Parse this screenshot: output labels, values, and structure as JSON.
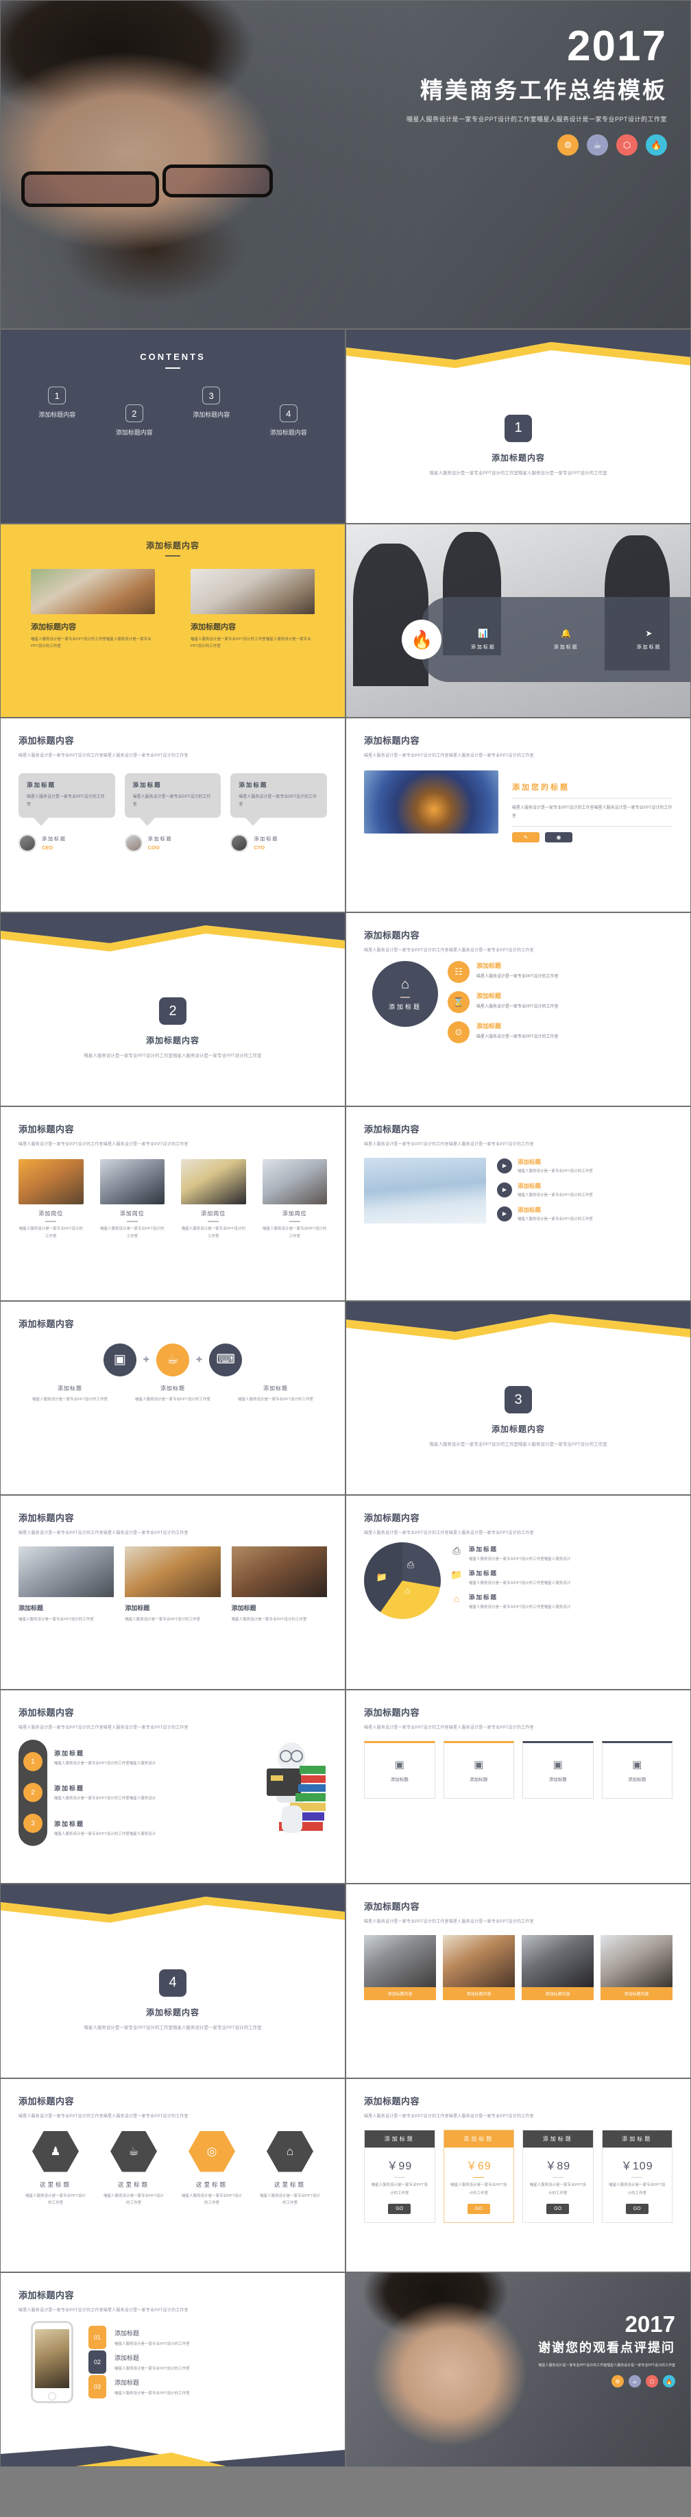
{
  "brand": {
    "navy": "#474d5e",
    "yellow": "#f9cb43",
    "orange": "#f5a93f",
    "gray": "#d8d8d8",
    "dark": "#4a4a4a"
  },
  "cover": {
    "year": "2017",
    "title": "精美商务工作总结模板",
    "subtitle": "喵星人服务设计是一家专业PPT设计的工作室喵星人服务设计是一家专业PPT设计的工作室",
    "icons": [
      {
        "name": "gear-icon",
        "glyph": "⚙",
        "color": "#f5a93f"
      },
      {
        "name": "cup-icon",
        "glyph": "☕",
        "color": "#9aa0c4"
      },
      {
        "name": "box-icon",
        "glyph": "⬡",
        "color": "#ef6b62"
      },
      {
        "name": "fire-icon",
        "glyph": "ᐃ",
        "color": "#3fc0dd"
      }
    ]
  },
  "contents": {
    "heading": "CONTENTS",
    "items": [
      {
        "num": "1",
        "label": "添加标题内容"
      },
      {
        "num": "2",
        "label": "添加标题内容"
      },
      {
        "num": "3",
        "label": "添加标题内容"
      },
      {
        "num": "4",
        "label": "添加标题内容"
      }
    ]
  },
  "section_dividers": [
    {
      "num": "1",
      "title": "添加标题内容",
      "desc": "喵星人服务设计是一家专业PPT设计的工作室喵星人服务设计是一家专业PPT设计的工作室"
    },
    {
      "num": "2",
      "title": "添加标题内容",
      "desc": "喵星人服务设计是一家专业PPT设计的工作室喵星人服务设计是一家专业PPT设计的工作室"
    },
    {
      "num": "3",
      "title": "添加标题内容",
      "desc": "喵星人服务设计是一家专业PPT设计的工作室喵星人服务设计是一家专业PPT设计的工作室"
    },
    {
      "num": "4",
      "title": "添加标题内容",
      "desc": "喵星人服务设计是一家专业PPT设计的工作室喵星人服务设计是一家专业PPT设计的工作室"
    }
  ],
  "common": {
    "title": "添加标题内容",
    "desc": "喵星人服务设计是一家专业PPT设计的工作室喵星人服务设计是一家专业PPT设计的工作室",
    "sub_title": "添加标题",
    "short_desc": "喵星人服务设计是一家专业PPT设计的工作室",
    "wrap_desc": "喵星人服务设计是一家专业PPT设计的工作室喵星人服务设计"
  },
  "yellow_cards": {
    "title": "添加标题内容",
    "cards": [
      {
        "title": "添加标题内容",
        "desc": "喵星人服务设计是一家专业PPT设计的工作室喵星人服务设计是一家专业PPT设计的工作室"
      },
      {
        "title": "添加标题内容",
        "desc": "喵星人服务设计是一家专业PPT设计的工作室喵星人服务设计是一家专业PPT设计的工作室"
      }
    ]
  },
  "meeting_pill": {
    "center_icon": "fire-icon",
    "options": [
      {
        "icon": "bar-chart-icon",
        "glyph": "ᴻ",
        "label": "添加标题"
      },
      {
        "icon": "bell-icon",
        "glyph": "ὑ4",
        "label": "添加标题"
      },
      {
        "icon": "send-icon",
        "glyph": "➤",
        "label": "添加标题"
      }
    ]
  },
  "team_bubbles": {
    "title": "添加标题内容",
    "desc": "喵星人服务设计是一家专业PPT设计的工作室喵星人服务设计是一家专业PPT设计的工作室",
    "members": [
      {
        "bubble_title": "添加标题",
        "bubble_desc": "喵星人服务设计是一家专业PPT设计的工作室",
        "name": "添加标题",
        "role": "CEO"
      },
      {
        "bubble_title": "添加标题",
        "bubble_desc": "喵星人服务设计是一家专业PPT设计的工作室",
        "name": "添加标题",
        "role": "COO"
      },
      {
        "bubble_title": "添加标题",
        "bubble_desc": "喵星人服务设计是一家专业PPT设计的工作室",
        "name": "添加标题",
        "role": "CTO"
      }
    ]
  },
  "handshake": {
    "title": "添加标题内容",
    "desc": "喵星人服务设计是一家专业PPT设计的工作室喵星人服务设计是一家专业PPT设计的工作室",
    "side_title": "添加您的标题",
    "side_desc": "喵星人服务设计是一家专业PPT设计的工作室喵星人服务设计是一家专业PPT设计的工作室",
    "buttons": [
      {
        "name": "pencil-button",
        "glyph": "✎",
        "color": "#f5a93f"
      },
      {
        "name": "eye-button",
        "glyph": "◉",
        "color": "#474d5e"
      }
    ]
  },
  "circle_chart": {
    "title": "添加标题内容",
    "desc": "喵星人服务设计是一家专业PPT设计的工作室喵星人服务设计是一家专业PPT设计的工作室",
    "center": {
      "icon": "home-dollar-icon",
      "label": "添加标题"
    },
    "items": [
      {
        "icon": "building-icon",
        "glyph": "☷",
        "title": "添加标题",
        "desc": "喵星人服务设计是一家专业PPT设计的工作室"
      },
      {
        "icon": "hourglass-icon",
        "glyph": "⌛",
        "title": "添加标题",
        "desc": "喵星人服务设计是一家专业PPT设计的工作室"
      },
      {
        "icon": "gift-icon",
        "glyph": "⊙",
        "title": "添加标题",
        "desc": "喵星人服务设计是一家专业PPT设计的工作室"
      }
    ]
  },
  "portrait_grid": {
    "title": "添加标题内容",
    "desc": "喵星人服务设计是一家专业PPT设计的工作室喵星人服务设计是一家专业PPT设计的工作室",
    "people": [
      {
        "role": "添加岗位",
        "desc": "喵星人服务设计是一家专业PPT设计的工作室"
      },
      {
        "role": "添加岗位",
        "desc": "喵星人服务设计是一家专业PPT设计的工作室"
      },
      {
        "role": "添加岗位",
        "desc": "喵星人服务设计是一家专业PPT设计的工作室"
      },
      {
        "role": "添加岗位",
        "desc": "喵星人服务设计是一家专业PPT设计的工作室"
      }
    ]
  },
  "mountain_list": {
    "title": "添加标题内容",
    "desc": "喵星人服务设计是一家专业PPT设计的工作室喵星人服务设计是一家专业PPT设计的工作室",
    "items": [
      {
        "icon": "play-icon",
        "glyph": "▶",
        "title": "添加标题",
        "desc": "喵星人服务设计是一家专业PPT设计的工作室"
      },
      {
        "icon": "play-icon",
        "glyph": "▶",
        "title": "添加标题",
        "desc": "喵星人服务设计是一家专业PPT设计的工作室"
      },
      {
        "icon": "play-icon",
        "glyph": "▶",
        "title": "添加标题",
        "desc": "喵星人服务设计是一家专业PPT设计的工作室"
      }
    ]
  },
  "three_circles": {
    "title": "添加标题内容",
    "items": [
      {
        "icon": "camera-icon",
        "glyph": "▣",
        "title": "添加标题",
        "desc": "喵星人服务设计是一家专业PPT设计的工作室",
        "active": false
      },
      {
        "icon": "cup-icon",
        "glyph": "☕",
        "title": "添加标题",
        "desc": "喵星人服务设计是一家专业PPT设计的工作室",
        "active": true
      },
      {
        "icon": "laptop-icon",
        "glyph": "⌸",
        "title": "添加标题",
        "desc": "喵星人服务设计是一家专业PPT设计的工作室",
        "active": false
      }
    ]
  },
  "three_photos": {
    "title": "添加标题内容",
    "desc": "喵星人服务设计是一家专业PPT设计的工作室喵星人服务设计是一家专业PPT设计的工作室",
    "cards": [
      {
        "title": "添加标题",
        "desc": "喵星人服务设计是一家专业PPT设计的工作室"
      },
      {
        "title": "添加标题",
        "desc": "喵星人服务设计是一家专业PPT设计的工作室"
      },
      {
        "title": "添加标题",
        "desc": "喵星人服务设计是一家专业PPT设计的工作室"
      }
    ]
  },
  "pie_slide": {
    "title": "添加标题内容",
    "desc": "喵星人服务设计是一家专业PPT设计的工作室喵星人服务设计是一家专业PPT设计的工作室",
    "legend": [
      {
        "icon": "monitor-icon",
        "glyph": "⎕",
        "title": "添加标题",
        "desc": "喵星人服务设计是一家专业PPT设计的工作室喵星人服务设计"
      },
      {
        "icon": "folder-icon",
        "glyph": "Ὄ1",
        "title": "添加标题",
        "desc": "喵星人服务设计是一家专业PPT设计的工作室喵星人服务设计"
      },
      {
        "icon": "home-dollar-icon",
        "glyph": "⌂",
        "title": "添加标题",
        "desc": "喵星人服务设计是一家专业PPT设计的工作室喵星人服务设计"
      }
    ]
  },
  "timeline": {
    "title": "添加标题内容",
    "desc": "喵星人服务设计是一家专业PPT设计的工作室喵星人服务设计是一家专业PPT设计的工作室",
    "steps": [
      {
        "num": "1",
        "title": "添加标题",
        "desc": "喵星人服务设计是一家专业PPT设计的工作室喵星人服务设计"
      },
      {
        "num": "2",
        "title": "添加标题",
        "desc": "喵星人服务设计是一家专业PPT设计的工作室喵星人服务设计"
      },
      {
        "num": "3",
        "title": "添加标题",
        "desc": "喵星人服务设计是一家专业PPT设计的工作室喵星人服务设计"
      }
    ]
  },
  "four_boxes": {
    "title": "添加标题内容",
    "desc": "喵星人服务设计是一家专业PPT设计的工作室喵星人服务设计是一家专业PPT设计的工作室",
    "boxes": [
      {
        "icon": "image-icon",
        "glyph": "▣",
        "title": "添加标题",
        "accent": "#f5a93f"
      },
      {
        "icon": "image-icon",
        "glyph": "▣",
        "title": "添加标题",
        "accent": "#f5a93f"
      },
      {
        "icon": "image-icon",
        "glyph": "▣",
        "title": "添加标题",
        "accent": "#474d5e"
      },
      {
        "icon": "image-icon",
        "glyph": "▣",
        "title": "添加标题",
        "accent": "#474d5e"
      }
    ]
  },
  "team_four": {
    "title": "添加标题内容",
    "desc": "喵星人服务设计是一家专业PPT设计的工作室喵星人服务设计是一家专业PPT设计的工作室",
    "cards": [
      {
        "label": "添加标题内容"
      },
      {
        "label": "添加标题内容"
      },
      {
        "label": "添加标题内容"
      },
      {
        "label": "添加标题内容"
      }
    ]
  },
  "hexagons": {
    "title": "添加标题内容",
    "desc": "喵星人服务设计是一家专业PPT设计的工作室喵星人服务设计是一家专业PPT设计的工作室",
    "items": [
      {
        "icon": "user-icon",
        "glyph": "♟",
        "title": "这里标题",
        "desc": "喵星人服务设计是一家专业PPT设计的工作室",
        "active": false
      },
      {
        "icon": "cup-icon",
        "glyph": "☕",
        "title": "这里标题",
        "desc": "喵星人服务设计是一家专业PPT设计的工作室",
        "active": false
      },
      {
        "icon": "target-icon",
        "glyph": "◎",
        "title": "这里标题",
        "desc": "喵星人服务设计是一家专业PPT设计的工作室",
        "active": true
      },
      {
        "icon": "home-dollar-icon",
        "glyph": "⌂",
        "title": "这里标题",
        "desc": "喵星人服务设计是一家专业PPT设计的工作室",
        "active": false
      }
    ]
  },
  "pricing": {
    "title": "添加标题内容",
    "desc": "喵星人服务设计是一家专业PPT设计的工作室喵星人服务设计是一家专业PPT设计的工作室",
    "plans": [
      {
        "header": "添加标题",
        "price": "￥99",
        "desc": "喵星人服务设计是一家专业PPT设计的工作室",
        "cta": "GO",
        "featured": false
      },
      {
        "header": "添加标题",
        "price": "￥69",
        "desc": "喵星人服务设计是一家专业PPT设计的工作室",
        "cta": "GO",
        "featured": true
      },
      {
        "header": "添加标题",
        "price": "￥89",
        "desc": "喵星人服务设计是一家专业PPT设计的工作室",
        "cta": "GO",
        "featured": false
      },
      {
        "header": "添加标题",
        "price": "￥109",
        "desc": "喵星人服务设计是一家专业PPT设计的工作室",
        "cta": "GO",
        "featured": false
      }
    ]
  },
  "phone_slide": {
    "title": "添加标题内容",
    "desc": "喵星人服务设计是一家专业PPT设计的工作室喵星人服务设计是一家专业PPT设计的工作室",
    "items": [
      {
        "num": "01",
        "title": "添加标题",
        "desc": "喵星人服务设计是一家专业PPT设计的工作室",
        "color": "#f5a93f"
      },
      {
        "num": "02",
        "title": "添加标题",
        "desc": "喵星人服务设计是一家专业PPT设计的工作室",
        "color": "#474d5e"
      },
      {
        "num": "03",
        "title": "添加标题",
        "desc": "喵星人服务设计是一家专业PPT设计的工作室",
        "color": "#f5a93f"
      }
    ]
  },
  "closing": {
    "year": "2017",
    "title": "谢谢您的观看点评提问",
    "subtitle": "喵星人服务设计是一家专业PPT设计的工作室喵星人服务设计是一家专业PPT设计的工作室",
    "icons": [
      {
        "name": "gear-icon",
        "glyph": "⚙",
        "color": "#f5a93f"
      },
      {
        "name": "cup-icon",
        "glyph": "☕",
        "color": "#9aa0c4"
      },
      {
        "name": "box-icon",
        "glyph": "⬡",
        "color": "#ef6b62"
      },
      {
        "name": "fire-icon",
        "glyph": "ᐃ",
        "color": "#3fc0dd"
      }
    ]
  }
}
